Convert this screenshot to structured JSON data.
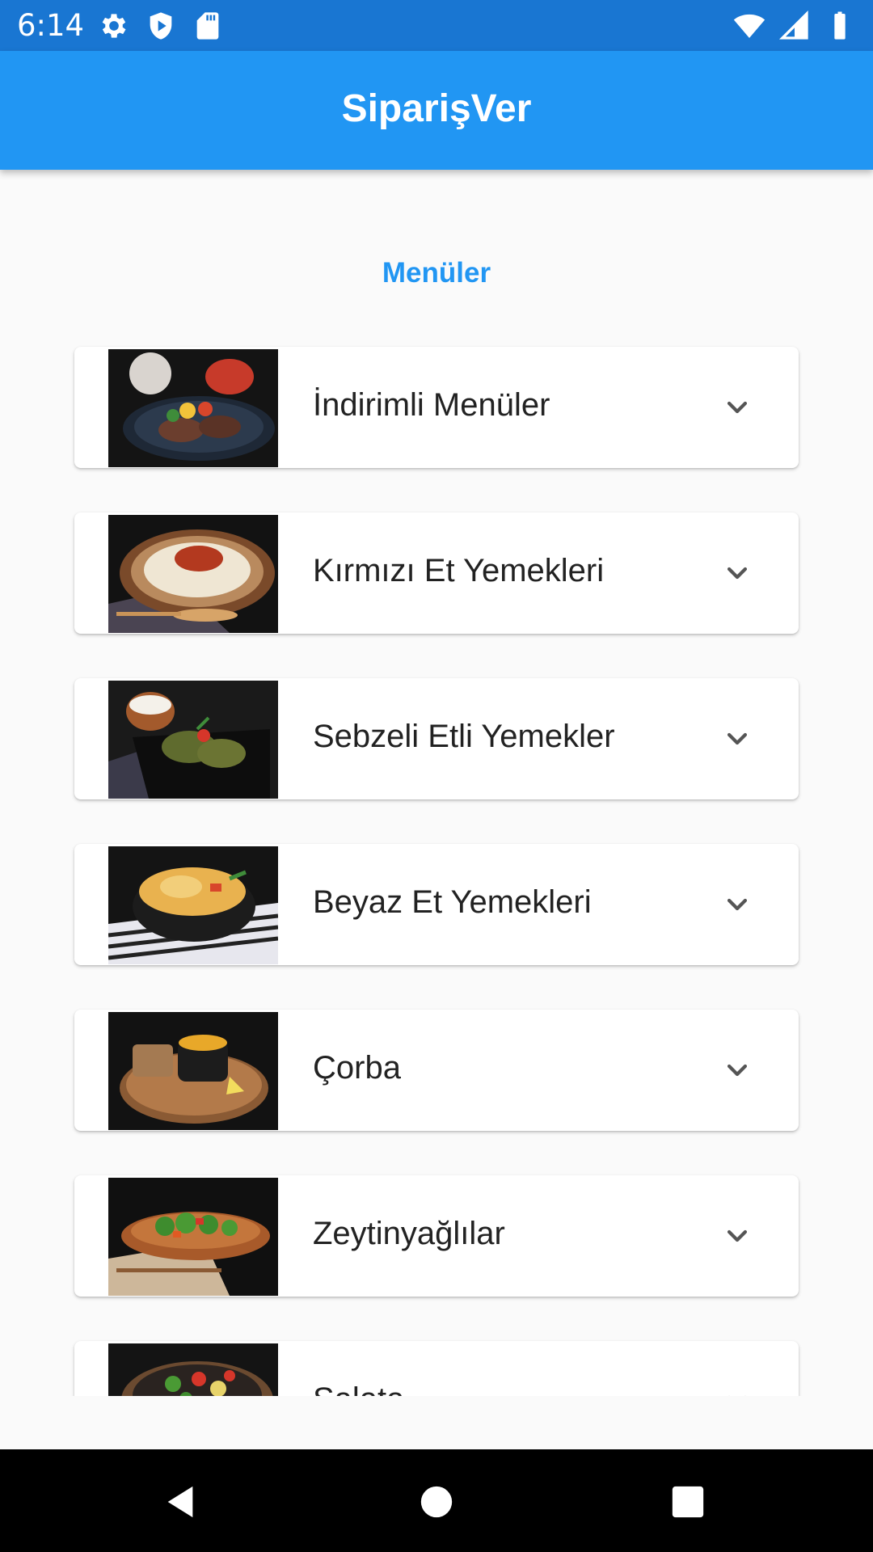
{
  "status_bar": {
    "time": "6:14",
    "color": "#1976d2"
  },
  "app_bar": {
    "title": "SiparişVer",
    "color": "#2196f3"
  },
  "section": {
    "title": "Menüler"
  },
  "menus": [
    {
      "label": "İndirimli Menüler",
      "image": "grilled-meat-plate"
    },
    {
      "label": "Kırmızı Et Yemekleri",
      "image": "meat-stew-puree"
    },
    {
      "label": "Sebzeli Etli Yemekler",
      "image": "stuffed-vine-leaves"
    },
    {
      "label": "Beyaz Et Yemekleri",
      "image": "chicken-bowl"
    },
    {
      "label": "Çorba",
      "image": "soup-cup"
    },
    {
      "label": "Zeytinyağlılar",
      "image": "broccoli-dish"
    },
    {
      "label": "Salata",
      "image": "salad-bowl"
    }
  ],
  "icons": {
    "settings": "gear-icon",
    "shield": "shield-play-icon",
    "sd_card": "sd-card-icon",
    "wifi": "wifi-icon",
    "signal": "signal-icon",
    "battery": "battery-icon",
    "expand": "chevron-down-icon",
    "back": "back-icon",
    "home": "home-icon",
    "recents": "recents-icon"
  }
}
